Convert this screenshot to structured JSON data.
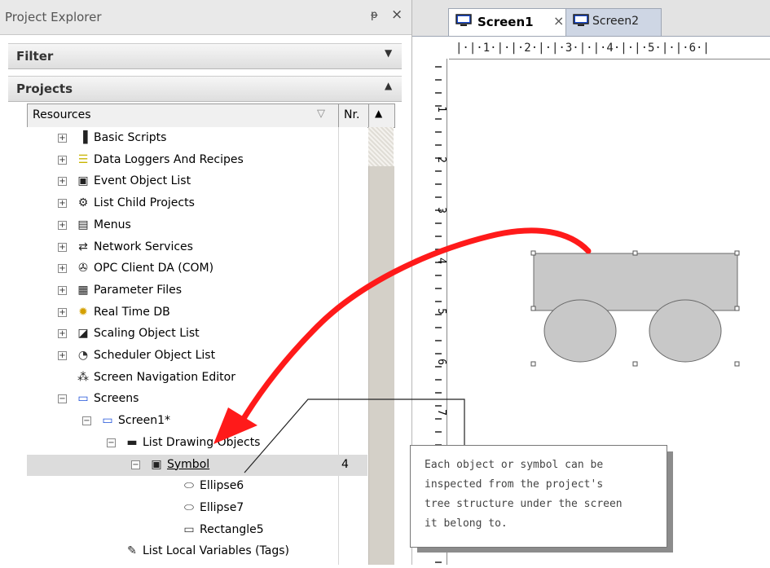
{
  "explorer": {
    "title": "Project Explorer",
    "pin": "ᵽ",
    "close": "×",
    "filter_label": "Filter",
    "projects_label": "Projects",
    "columns": {
      "resources": "Resources",
      "filter_glyph": "▽",
      "nr": "Nr."
    },
    "tree": [
      {
        "label": "Basic Scripts",
        "icon": "script-icon",
        "expander": "⊞"
      },
      {
        "label": "Data Loggers And Recipes",
        "icon": "database-icon",
        "expander": "⊞"
      },
      {
        "label": "Event Object List",
        "icon": "event-icon",
        "expander": "⊞"
      },
      {
        "label": "List Child Projects",
        "icon": "gears-icon",
        "expander": "⊞"
      },
      {
        "label": "Menus",
        "icon": "menu-icon",
        "expander": "⊞"
      },
      {
        "label": "Network Services",
        "icon": "network-icon",
        "expander": "⊞"
      },
      {
        "label": "OPC Client DA (COM)",
        "icon": "opc-icon",
        "expander": "⊞"
      },
      {
        "label": "Parameter Files",
        "icon": "parameter-file-icon",
        "expander": "⊞"
      },
      {
        "label": "Real Time DB",
        "icon": "realtime-db-icon",
        "expander": "⊞"
      },
      {
        "label": "Scaling Object List",
        "icon": "scaling-icon",
        "expander": "⊞"
      },
      {
        "label": "Scheduler Object List",
        "icon": "scheduler-clock-icon",
        "expander": "⊞"
      },
      {
        "label": "Screen Navigation Editor",
        "icon": "navigation-tree-icon",
        "expander": ""
      },
      {
        "label": "Screens",
        "icon": "screens-icon",
        "expander": "⊟"
      },
      {
        "label": "Screen1*",
        "icon": "screen-icon",
        "expander": "⊟"
      },
      {
        "label": "List Drawing Objects",
        "icon": "folder-icon",
        "expander": "⊟"
      },
      {
        "label": "Symbol",
        "icon": "symbol-icon",
        "expander": "⊟",
        "nr": "4"
      },
      {
        "label": "Ellipse6",
        "icon": "ellipse-icon",
        "expander": ""
      },
      {
        "label": "Ellipse7",
        "icon": "ellipse-icon",
        "expander": ""
      },
      {
        "label": "Rectangle5",
        "icon": "rectangle-icon",
        "expander": ""
      },
      {
        "label": "List Local Variables (Tags)",
        "icon": "variables-icon",
        "expander": ""
      }
    ]
  },
  "editor": {
    "tabs": [
      {
        "label": "Screen1",
        "close": "×",
        "active": true
      },
      {
        "label": "Screen2",
        "active": false
      }
    ],
    "ruler_top_text": "|·|·1·|·|·2·|·|·3·|·|·4·|·|·5·|·|·6·|",
    "ruler_left_numbers": [
      "1",
      "2",
      "3",
      "4",
      "5",
      "6",
      "7"
    ]
  },
  "callout": {
    "lines": [
      "Each object or symbol can be",
      "inspected from the project's",
      "tree structure under the screen",
      "it belong to."
    ]
  },
  "colors": {
    "arrow": "#ff1a1a",
    "shape_fill": "#c8c8c8",
    "tab_active": "#ffffff",
    "tab_inactive": "#ced6e4",
    "screen_icon_blue": "#1c4fd8"
  }
}
